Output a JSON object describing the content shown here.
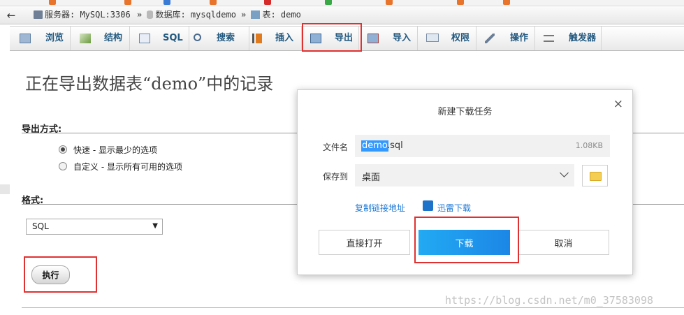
{
  "breadcrumb": {
    "server": "服务器: MySQL:3306",
    "database": "数据库: mysqldemo",
    "table": "表: demo"
  },
  "tabs": [
    {
      "label": "浏览",
      "icon": "browse-icon"
    },
    {
      "label": "结构",
      "icon": "structure-icon"
    },
    {
      "label": "SQL",
      "icon": "sql-icon"
    },
    {
      "label": "搜索",
      "icon": "search-icon"
    },
    {
      "label": "插入",
      "icon": "insert-icon"
    },
    {
      "label": "导出",
      "icon": "export-icon",
      "highlighted": true
    },
    {
      "label": "导入",
      "icon": "import-icon"
    },
    {
      "label": "权限",
      "icon": "privileges-icon"
    },
    {
      "label": "操作",
      "icon": "wrench-icon"
    },
    {
      "label": "触发器",
      "icon": "triggers-icon"
    }
  ],
  "page": {
    "title": "正在导出数据表“demo”中的记录",
    "export_method_label": "导出方式:",
    "options": [
      {
        "label": "快速 - 显示最少的选项",
        "checked": true
      },
      {
        "label": "自定义 - 显示所有可用的选项",
        "checked": false
      }
    ],
    "format_label": "格式:",
    "format_value": "SQL",
    "execute_label": "执行"
  },
  "dialog": {
    "title": "新建下载任务",
    "close": "×",
    "filename_label": "文件名",
    "filename_selected": "demo",
    "filename_ext": ".sql",
    "file_size": "1.08KB",
    "save_to_label": "保存到",
    "save_to_value": "桌面",
    "copy_link": "复制链接地址",
    "xunlei_download": "迅雷下载",
    "open_direct": "直接打开",
    "download": "下载",
    "cancel": "取消"
  },
  "watermark": "https://blog.csdn.net/m0_37583098",
  "colors": {
    "tab_text": "#235a81",
    "highlight": "#e03131",
    "primary_button": "#1c86e6",
    "link": "#1f7ad6"
  }
}
